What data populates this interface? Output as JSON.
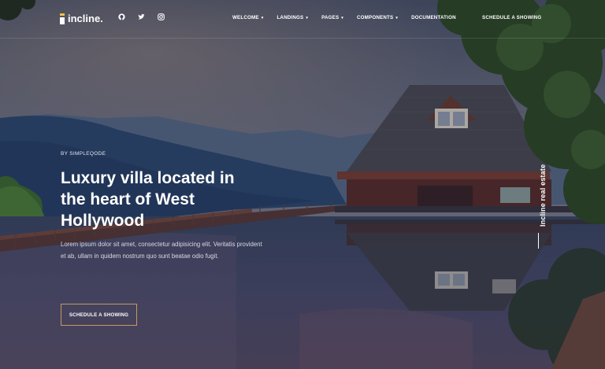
{
  "brand": {
    "name": "incline."
  },
  "socials": [
    {
      "icon": "github-icon"
    },
    {
      "icon": "twitter-icon"
    },
    {
      "icon": "instagram-icon"
    }
  ],
  "menu": [
    {
      "label": "WELCOME",
      "dropdown": true
    },
    {
      "label": "LANDINGS",
      "dropdown": true
    },
    {
      "label": "PAGES",
      "dropdown": true
    },
    {
      "label": "COMPONENTS",
      "dropdown": true
    },
    {
      "label": "DOCUMENTATION",
      "dropdown": false
    }
  ],
  "header_cta": "SCHEDULE A SHOWING",
  "hero": {
    "eyebrow": "BY SIMPLEQODE",
    "title": "Luxury villa located in the heart of West Hollywood",
    "description": "Lorem ipsum dolor sit amet, consectetur adipisicing elit. Veritatis provident et ab, ullam in quidem nostrum quo sunt beatae odio fugit.",
    "cta": "SCHEDULE A SHOWING"
  },
  "side_label": "Incline real estate",
  "colors": {
    "accent": "#c29b5e",
    "text": "#ffffff"
  }
}
